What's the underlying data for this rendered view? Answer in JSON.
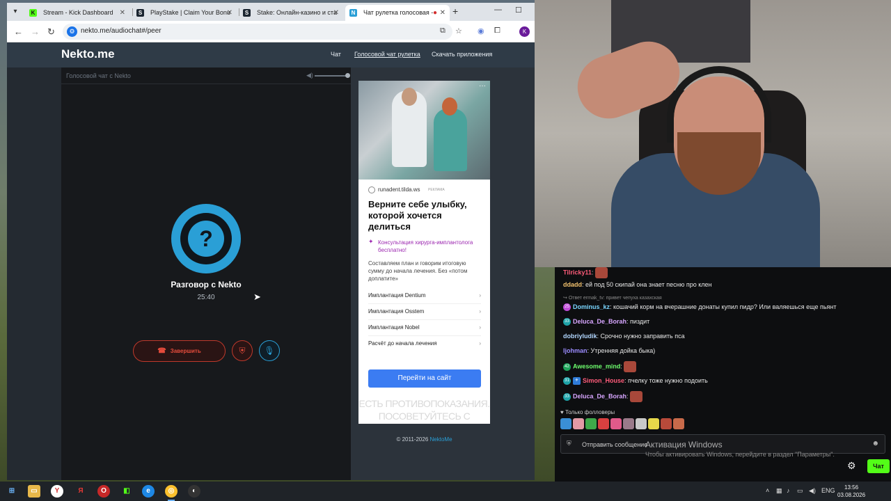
{
  "browser": {
    "tabs": [
      {
        "title": "Stream - Kick Dashboard",
        "favicon": "K",
        "color": "#53fc18"
      },
      {
        "title": "PlayStake | Claim Your Bonus",
        "favicon": "S",
        "color": "#1b2530"
      },
      {
        "title": "Stake: Онлайн-казино и став",
        "favicon": "S",
        "color": "#1b2530"
      },
      {
        "title": "Чат рулетка голосовая -",
        "favicon": "N",
        "color": "#2a9fd6"
      }
    ],
    "url": "nekto.me/audiochat#/peer",
    "profile_initial": "K"
  },
  "site": {
    "logo": "Nekto.me",
    "nav": [
      "Чат",
      "Голосовой чат рулетка",
      "Скачать приложения"
    ],
    "panel_title": "Голосовой чат с Nekto",
    "avatar_glyph": "?",
    "peer_name": "Разговор с Nekto",
    "timer": "25:40",
    "end_button": "Завершить",
    "volume_level": 1.0,
    "footer_text": "© 2011-2026",
    "footer_link": "NektoMe"
  },
  "ad": {
    "domain": "runadent.tilda.ws",
    "tag": "РЕКЛАМА",
    "headline": "Верните себе улыбку, которой хочется делиться",
    "offer": "Консультация хирурга-имплантолога бесплатно!",
    "description": "Составляем план и говорим итоговую сумму до начала лечения. Без «потом доплатите»",
    "items": [
      "Имплантация Dentium",
      "Имплантация Osstem",
      "Имплантация Nobel",
      "Расчёт до начала лечения"
    ],
    "cta": "Перейти на сайт",
    "warning": "ЕСТЬ ПРОТИВОПОКАЗАНИЯ. ПОСОВЕТУЙТЕСЬ С ВРАЧОМ"
  },
  "chat": {
    "messages": [
      {
        "user": "ddadd",
        "color": "#f3c26e",
        "text": ": ей под 50 скипай она знает песню про клен"
      },
      {
        "user": "Dominus_kz",
        "color": "#7ad6ff",
        "badge": "25",
        "badge_color": "#c04bd8",
        "text": ": кошачий корм на вчерашние донаты купил пидр? Или валяешься еще пьянт"
      },
      {
        "user": "Deluca_De_Borah",
        "color": "#d7a6ff",
        "badge": "33",
        "badge_color": "#1ea3a8",
        "text": ": пиздит"
      },
      {
        "user": "dobriyludik",
        "color": "#b2d7ff",
        "text": ": Срочно нужно заправить пса"
      },
      {
        "user": "ljohman",
        "color": "#9c8cff",
        "text": ": Утренняя дойка быка)"
      },
      {
        "user": "Awesome_mind",
        "color": "#6eff6e",
        "badge": "42",
        "badge_color": "#1ea35a",
        "text": ":"
      },
      {
        "user": "Simon_House",
        "color": "#ff5c7a",
        "badge": "31",
        "badge_color": "#1ea3a8",
        "text": ": пчелку тоже нужно подоить"
      },
      {
        "user": "Deluca_De_Borah",
        "color": "#d7a6ff",
        "badge": "33",
        "badge_color": "#1ea3a8",
        "text": ":"
      }
    ],
    "top_user": "Tilricky11",
    "reply_note": "Ответ ermak_tv: привет чепуха казахская",
    "followers_only": "Только фолловеры",
    "input_placeholder": "Отправить сообщение",
    "send_label": "Чат",
    "windows_activation": "Активация Windows",
    "windows_activation_sub": "Чтобы активировать Windows, перейдите в раздел \"Параметры\"."
  },
  "taskbar": {
    "lang": "ENG",
    "time": "13:56",
    "date": "03.08.2026"
  }
}
